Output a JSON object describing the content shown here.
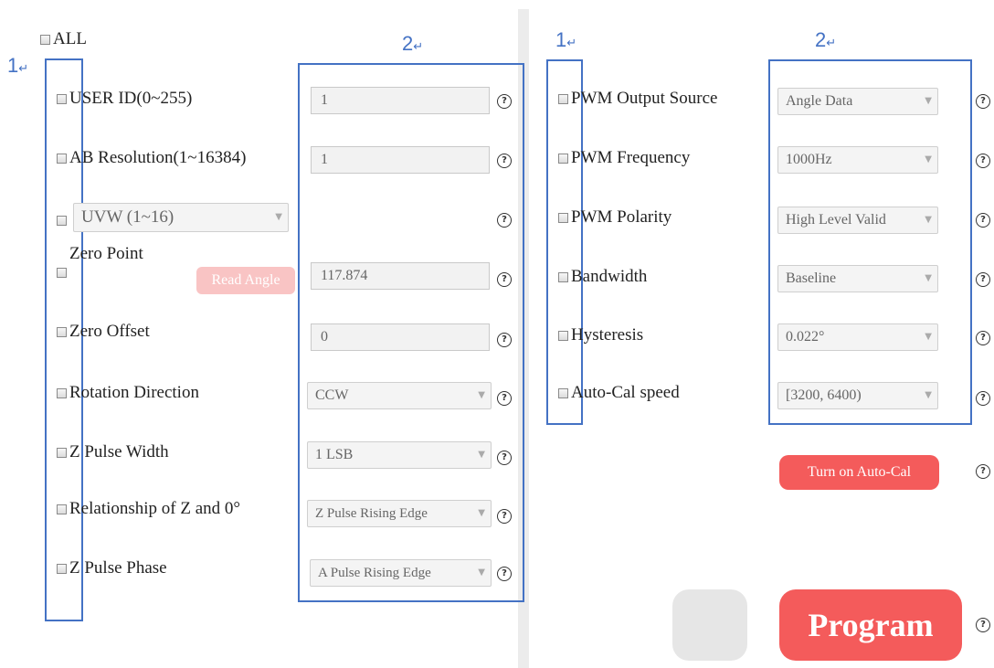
{
  "colors": {
    "accent_red": "#f45b5b",
    "faint_red": "#f9c4c4",
    "annotation_blue": "#4472c4"
  },
  "annotations": {
    "col1": "1",
    "col2": "2",
    "mark": "↵"
  },
  "left": {
    "all_label": "ALL",
    "read_angle_label": "Read Angle",
    "rows": [
      {
        "label": "USER ID(0~255)",
        "value": "1"
      },
      {
        "label": "AB Resolution(1~16384)",
        "value": "1"
      },
      {
        "label": "",
        "select": "UVW (1~16)"
      },
      {
        "label": "Zero Point",
        "value": "117.874"
      },
      {
        "label": "Zero Offset",
        "value": "0"
      },
      {
        "label": "Rotation Direction",
        "value": "CCW"
      },
      {
        "label": "Z Pulse Width",
        "value": "1 LSB"
      },
      {
        "label": "Relationship of Z and 0°",
        "value": "Z Pulse Rising Edge"
      },
      {
        "label": "Z Pulse Phase",
        "value": "A Pulse Rising Edge"
      }
    ]
  },
  "right": {
    "rows": [
      {
        "label": "PWM Output Source",
        "value": "Angle Data"
      },
      {
        "label": "PWM Frequency",
        "value": "1000Hz"
      },
      {
        "label": "PWM Polarity",
        "value": "High Level Valid"
      },
      {
        "label": "Bandwidth",
        "value": "Baseline"
      },
      {
        "label": "Hysteresis",
        "value": "0.022°"
      },
      {
        "label": "Auto-Cal speed",
        "value": "[3200, 6400)"
      }
    ],
    "autocal_button": "Turn on Auto-Cal",
    "program_button": "Program"
  },
  "help_glyph": "?",
  "dropdown_glyph": "▼"
}
